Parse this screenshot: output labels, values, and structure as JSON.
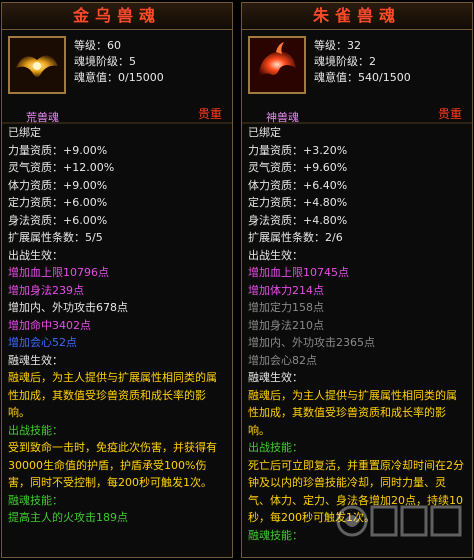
{
  "left": {
    "title": "金乌兽魂",
    "level": "等级：60",
    "realm_level": "魂境阶级：5",
    "soul_value": "魂意值：0/15000",
    "type_label": "荒兽魂",
    "rarity": "贵重",
    "bound": "已绑定",
    "stats": [
      {
        "label": "力量资质：",
        "value": "+9.00%"
      },
      {
        "label": "灵气资质：",
        "value": "+12.00%"
      },
      {
        "label": "体力资质：",
        "value": "+9.00%"
      },
      {
        "label": "定力资质：",
        "value": "+6.00%"
      },
      {
        "label": "身法资质：",
        "value": "+6.00%"
      }
    ],
    "expand_count": "扩展属性条数：5/5",
    "battle_effect_label": "出战生效：",
    "effects": [
      {
        "text": "增加血上限10796点",
        "color": "magenta"
      },
      {
        "text": "增加身法239点",
        "color": "magenta"
      },
      {
        "text": "增加内、外功攻击678点",
        "color": "white"
      },
      {
        "text": "增加命中3402点",
        "color": "magenta"
      },
      {
        "text": "增加会心52点",
        "color": "blue"
      }
    ],
    "blend_label": "融魂生效：",
    "blend_text": "融魂后，为主人提供与扩展属性相同类的属性加成，其数值受珍兽资质和成长率的影响。",
    "skill_label": "出战技能：",
    "skill_text": "受到致命一击时，免疫此次伤害，并获得有30000生命值的护盾，护盾承受100%伤害，同时不受控制，每200秒可触发1次。",
    "blend_skill_label": "融魂技能：",
    "blend_skill_text": "提高主人的火攻击189点"
  },
  "right": {
    "title": "朱雀兽魂",
    "level": "等级：32",
    "realm_level": "魂境阶级：2",
    "soul_value": "魂意值：540/1500",
    "type_label": "神兽魂",
    "rarity": "贵重",
    "bound": "已绑定",
    "stats": [
      {
        "label": "力量资质：",
        "value": "+3.20%"
      },
      {
        "label": "灵气资质：",
        "value": "+9.60%"
      },
      {
        "label": "体力资质：",
        "value": "+6.40%"
      },
      {
        "label": "定力资质：",
        "value": "+4.80%"
      },
      {
        "label": "身法资质：",
        "value": "+4.80%"
      }
    ],
    "expand_count": "扩展属性条数：2/6",
    "battle_effect_label": "出战生效：",
    "effects": [
      {
        "text": "增加血上限10745点",
        "color": "magenta"
      },
      {
        "text": "增加体力214点",
        "color": "magenta"
      },
      {
        "text": "增加定力158点",
        "color": "grey"
      },
      {
        "text": "增加身法210点",
        "color": "grey"
      },
      {
        "text": "增加内、外功攻击2365点",
        "color": "grey"
      },
      {
        "text": "增加会心82点",
        "color": "grey"
      }
    ],
    "blend_label": "融魂生效：",
    "blend_text": "融魂后，为主人提供与扩展属性相同类的属性加成，其数值受珍兽资质和成长率的影响。",
    "skill_label": "出战技能：",
    "skill_text": "死亡后可立即复活，并重置原冷却时间在2分钟及以内的珍兽技能冷却，同时力量、灵气、体力、定力、身法各增加20点，持续10秒，每200秒可触发1次。",
    "blend_skill_label": "融魂技能："
  }
}
